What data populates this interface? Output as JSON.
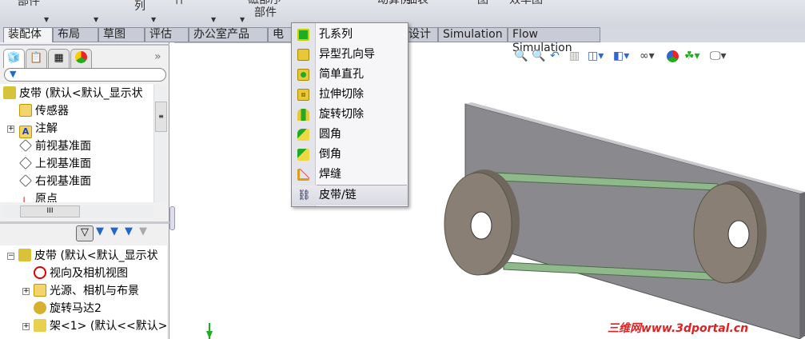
{
  "toolbar": {
    "labels": [
      "部件",
      "列",
      "什",
      "磁部序",
      "部件",
      "动算例",
      "细表",
      "图",
      "效率图"
    ]
  },
  "tabs": [
    "装配体",
    "布局",
    "草图",
    "评估",
    "办公室产品",
    "电",
    "设计",
    "Simulation",
    "Flow Simulation"
  ],
  "feature_tree": {
    "filter_label": "▼",
    "expand_label": "»",
    "items": [
      {
        "label": "皮带  (默认<默认_显示状",
        "icon": "assembly-icon"
      },
      {
        "label": "传感器",
        "icon": "sensor-folder-icon"
      },
      {
        "label": "注解",
        "icon": "annotation-folder-icon"
      },
      {
        "label": "前视基准面",
        "icon": "plane-icon"
      },
      {
        "label": "上视基准面",
        "icon": "plane-icon"
      },
      {
        "label": "右视基准面",
        "icon": "plane-icon"
      },
      {
        "label": "原点",
        "icon": "origin-icon"
      }
    ],
    "scroll_grip": "III"
  },
  "motion_tree": {
    "items": [
      {
        "label": "皮带  (默认<默认_显示状",
        "icon": "assembly-icon"
      },
      {
        "label": "视向及相机视图",
        "icon": "camera-view-icon"
      },
      {
        "label": "光源、相机与布景",
        "icon": "lights-folder-icon"
      },
      {
        "label": "旋转马达2",
        "icon": "rotary-motor-icon"
      },
      {
        "label": "架<1> (默认<<默认>",
        "icon": "part-icon"
      }
    ]
  },
  "dropdown_menu": {
    "items": [
      {
        "label": "孔系列",
        "icon": "hole-series-icon"
      },
      {
        "label": "异型孔向导",
        "icon": "hole-wizard-icon"
      },
      {
        "label": "简单直孔",
        "icon": "simple-hole-icon"
      },
      {
        "label": "拉伸切除",
        "icon": "extruded-cut-icon"
      },
      {
        "label": "旋转切除",
        "icon": "revolved-cut-icon"
      },
      {
        "label": "圆角",
        "icon": "fillet-icon"
      },
      {
        "label": "倒角",
        "icon": "chamfer-icon"
      },
      {
        "label": "焊缝",
        "icon": "weld-bead-icon"
      },
      {
        "label": "皮带/链",
        "icon": "belt-chain-icon"
      }
    ],
    "highlighted": "皮带/链"
  },
  "watermark": "三维网www.3dportal.cn",
  "colors": {
    "belt": "#8fb98a",
    "plate": "#8a8a8e",
    "pulley": "#8a7f74",
    "watermark": "#e02020"
  }
}
